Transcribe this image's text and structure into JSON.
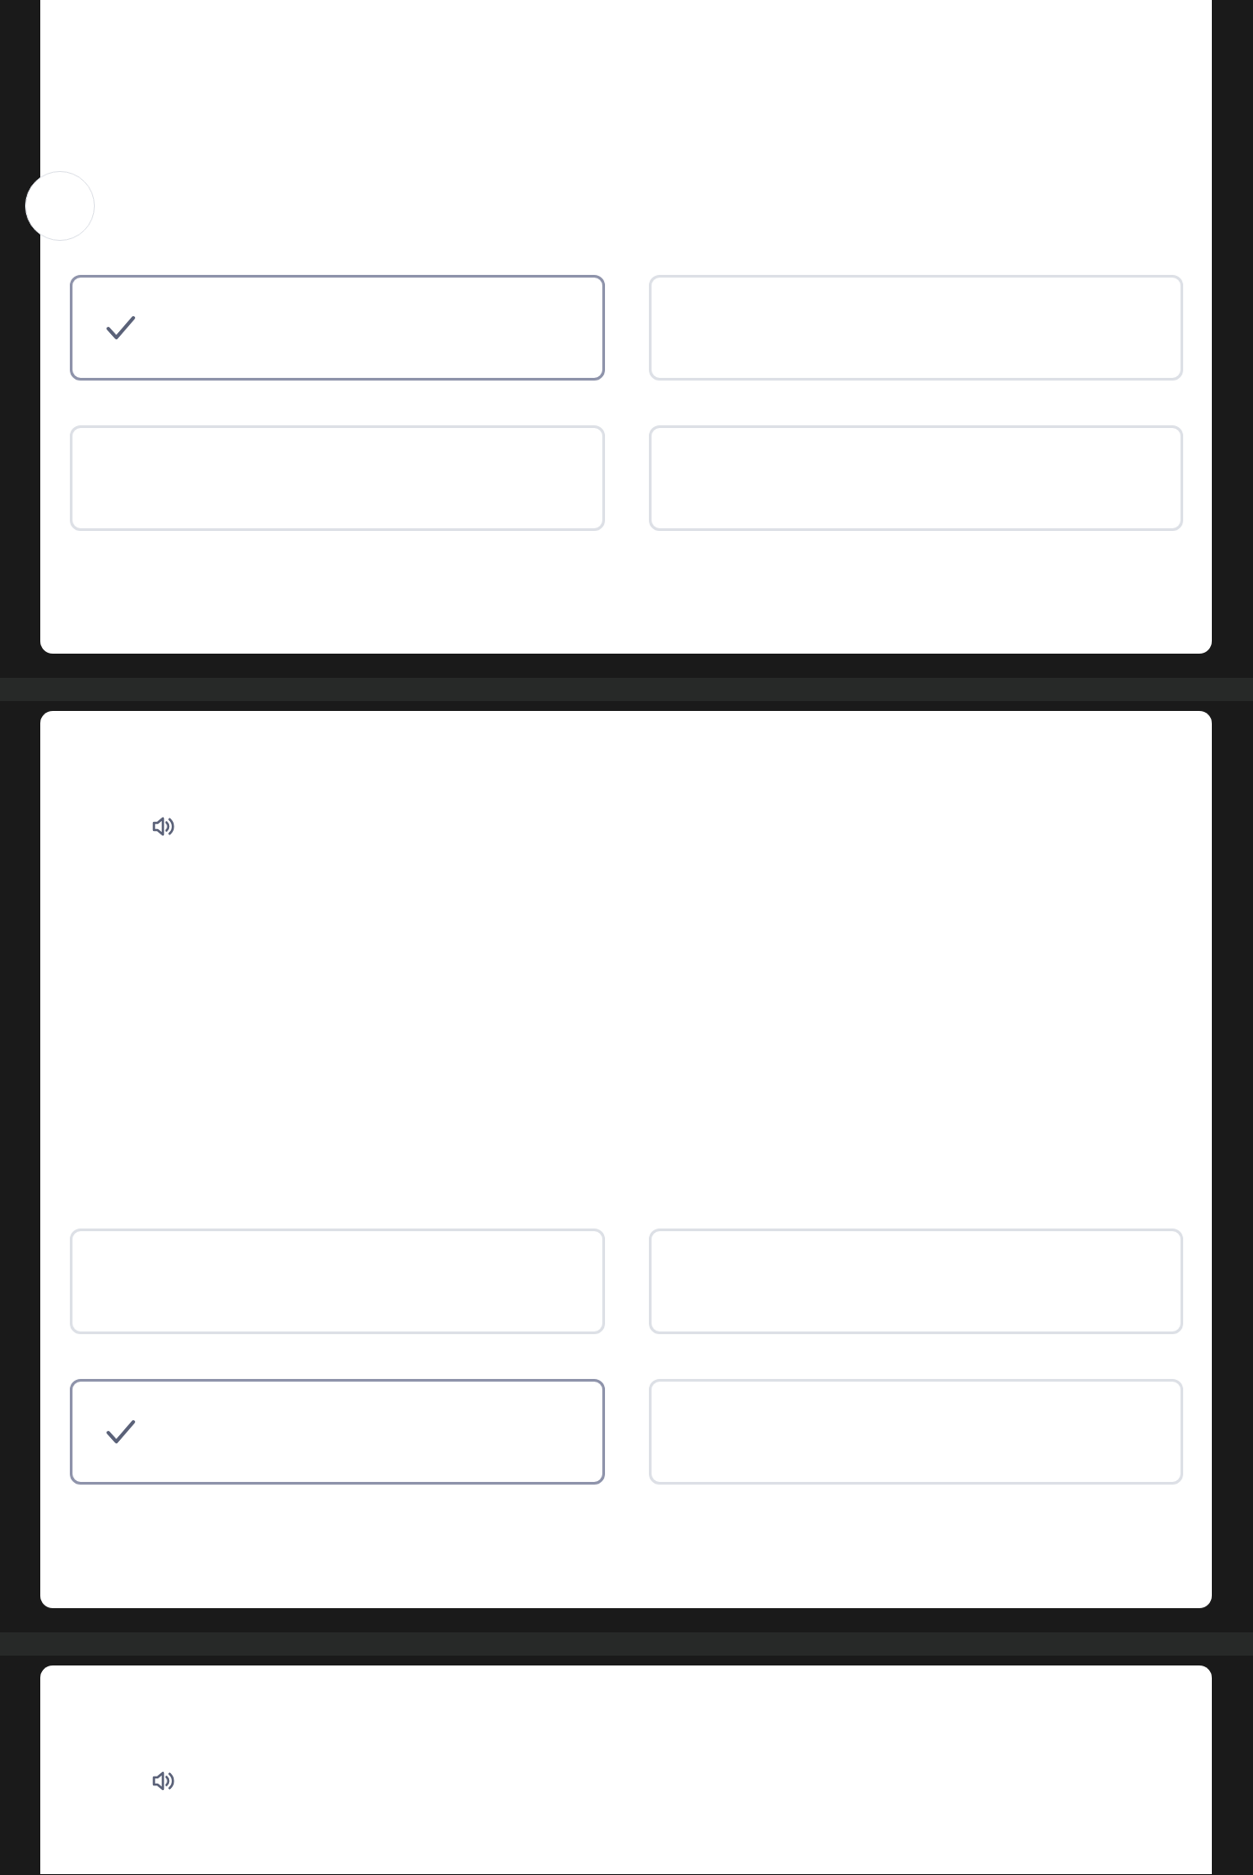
{
  "cards": [
    {
      "kind": "marker",
      "options": [
        {
          "selected": true
        },
        {
          "selected": false
        },
        {
          "selected": false
        },
        {
          "selected": false
        }
      ]
    },
    {
      "kind": "audio",
      "options": [
        {
          "selected": false
        },
        {
          "selected": false
        },
        {
          "selected": true
        },
        {
          "selected": false
        }
      ]
    },
    {
      "kind": "audio"
    }
  ]
}
